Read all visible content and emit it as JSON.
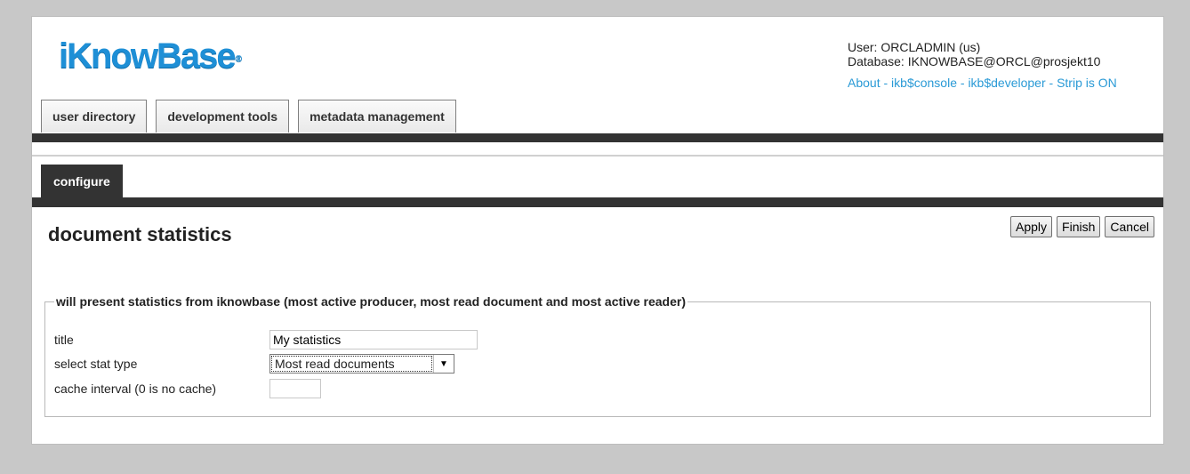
{
  "header": {
    "logo_text": "iKnowBase",
    "logo_mark": "®",
    "user_line": "User: ORCLADMIN (us)",
    "database_line": "Database: IKNOWBASE@ORCL@prosjekt10",
    "links": {
      "about": "About",
      "console": "ikb$console",
      "developer": "ikb$developer",
      "strip": "Strip is ON",
      "separator": " - "
    }
  },
  "main_tabs": [
    {
      "label": "user directory"
    },
    {
      "label": "development tools"
    },
    {
      "label": "metadata management"
    }
  ],
  "sub_tab": {
    "label": "configure"
  },
  "page": {
    "title": "document statistics"
  },
  "actions": {
    "apply": "Apply",
    "finish": "Finish",
    "cancel": "Cancel"
  },
  "form": {
    "legend": "will present statistics from iknowbase (most active producer, most read document and most active reader)",
    "title_label": "title",
    "title_value": "My statistics",
    "stat_type_label": "select stat type",
    "stat_type_value": "Most read documents",
    "cache_label": "cache interval (0 is no cache)",
    "cache_value": ""
  },
  "colors": {
    "background": "#c8c8c8",
    "logo_blue": "#1e8fd6",
    "link_blue": "#2a9ad6",
    "dark_bar": "#333333"
  }
}
